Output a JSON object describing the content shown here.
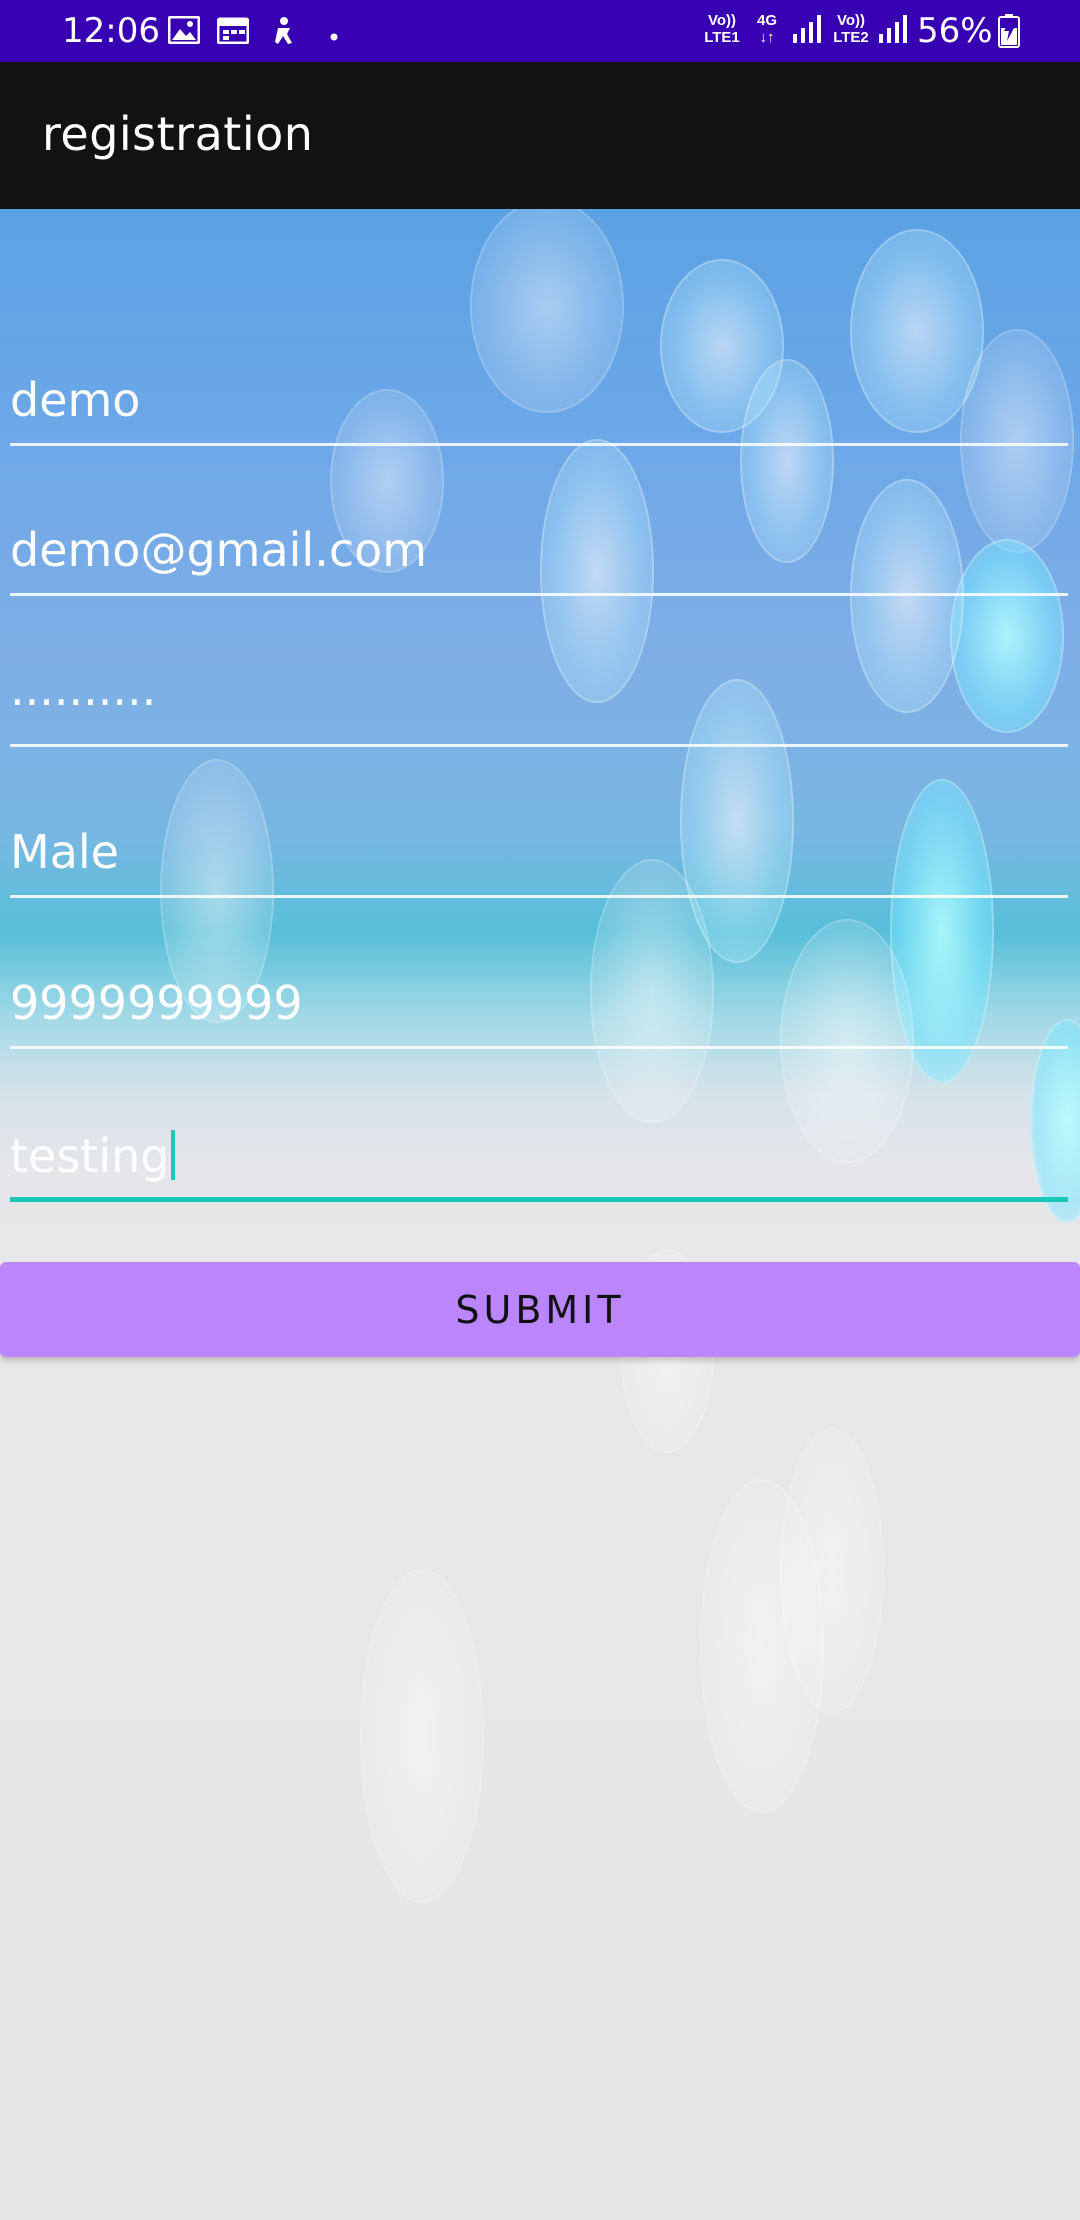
{
  "status_bar": {
    "time": "12:06",
    "icons": [
      "image-icon",
      "calendar-icon",
      "accessibility-icon",
      "dot-icon"
    ],
    "sim1_volte": "Vo))",
    "sim1_lte": "LTE1",
    "network_type": "4G",
    "sim2_volte": "Vo))",
    "sim2_lte": "LTE2",
    "battery": "56%"
  },
  "app_bar": {
    "title": "registration"
  },
  "form": {
    "name_value": "demo",
    "email_value": "demo@gmail.com",
    "password_value": "..........",
    "gender_value": "Male",
    "phone_value": "9999999999",
    "address_value": "testing"
  },
  "actions": {
    "submit_label": "SUBMIT"
  },
  "colors": {
    "status_bar": "#3700b3",
    "app_bar": "#121212",
    "button": "#bb86fc",
    "focus_accent": "#17c9b6"
  }
}
